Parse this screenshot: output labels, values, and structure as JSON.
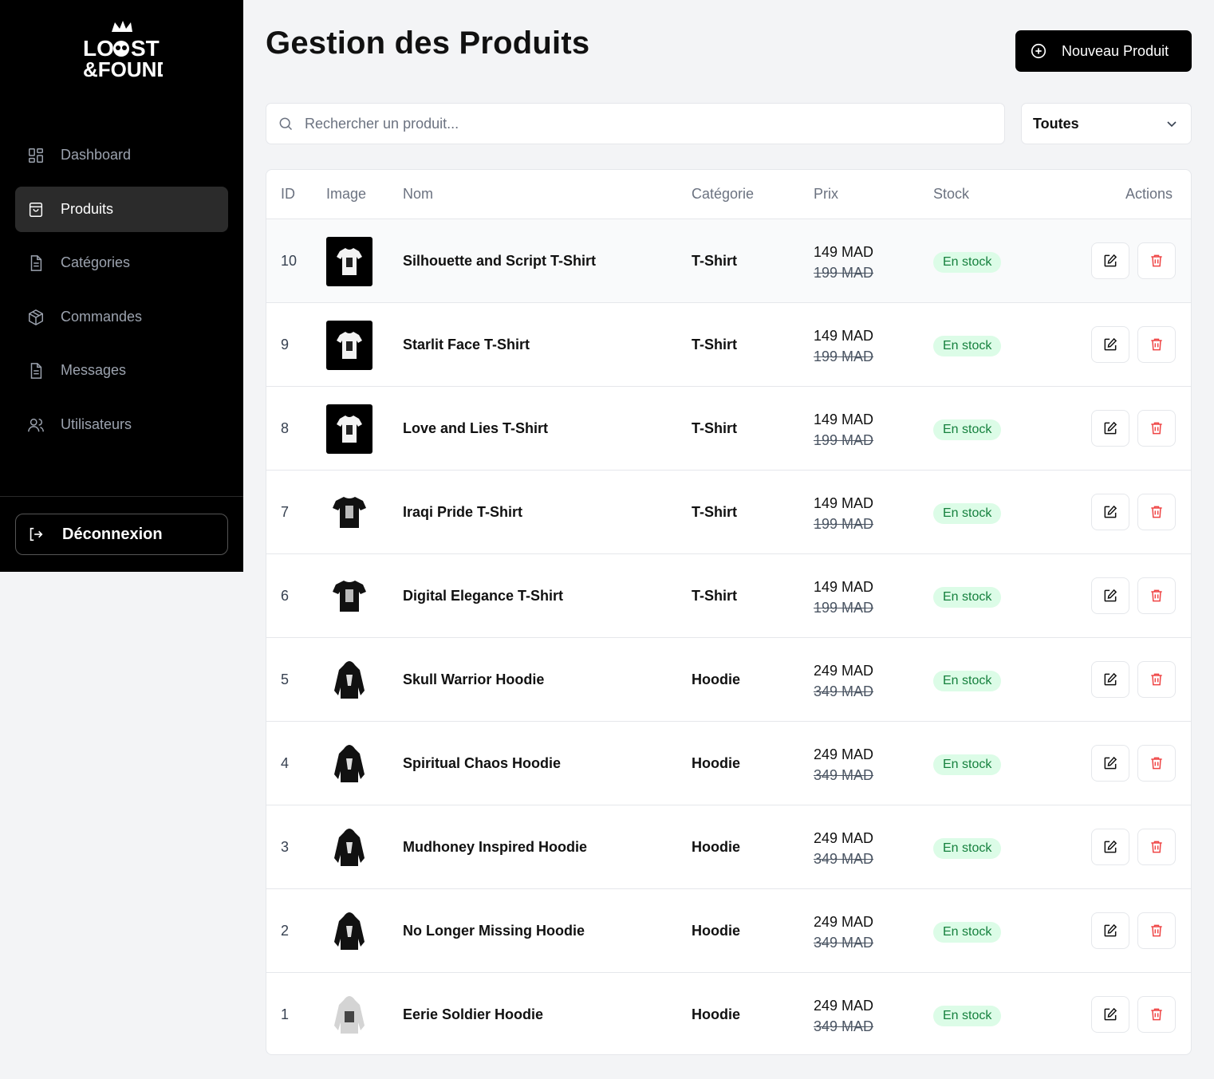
{
  "brand": {
    "logo_text_top": "LOST",
    "logo_text_bottom": "&FOUND"
  },
  "sidebar": {
    "items": [
      {
        "label": "Dashboard",
        "icon": "grid-icon"
      },
      {
        "label": "Produits",
        "icon": "shopping-bag-icon",
        "active": true
      },
      {
        "label": "Catégories",
        "icon": "document-icon"
      },
      {
        "label": "Commandes",
        "icon": "package-icon"
      },
      {
        "label": "Messages",
        "icon": "document-icon"
      },
      {
        "label": "Utilisateurs",
        "icon": "users-icon"
      }
    ],
    "logout_label": "Déconnexion"
  },
  "header": {
    "title": "Gestion des Produits",
    "new_button_label": "Nouveau Produit"
  },
  "filters": {
    "search_placeholder": "Rechercher un produit...",
    "category_selected": "Toutes"
  },
  "table": {
    "columns": [
      "ID",
      "Image",
      "Nom",
      "Catégorie",
      "Prix",
      "Stock",
      "Actions"
    ],
    "rows": [
      {
        "id": "10",
        "name": "Silhouette and Script T-Shirt",
        "category": "T-Shirt",
        "price": "149 MAD",
        "old_price": "199 MAD",
        "stock": "En stock",
        "image": "tshirt-black-bg"
      },
      {
        "id": "9",
        "name": "Starlit Face T-Shirt",
        "category": "T-Shirt",
        "price": "149 MAD",
        "old_price": "199 MAD",
        "stock": "En stock",
        "image": "tshirt-black-bg"
      },
      {
        "id": "8",
        "name": "Love and Lies T-Shirt",
        "category": "T-Shirt",
        "price": "149 MAD",
        "old_price": "199 MAD",
        "stock": "En stock",
        "image": "tshirt-black-bg"
      },
      {
        "id": "7",
        "name": "Iraqi Pride T-Shirt",
        "category": "T-Shirt",
        "price": "149 MAD",
        "old_price": "199 MAD",
        "stock": "En stock",
        "image": "tshirt-black"
      },
      {
        "id": "6",
        "name": "Digital Elegance T-Shirt",
        "category": "T-Shirt",
        "price": "149 MAD",
        "old_price": "199 MAD",
        "stock": "En stock",
        "image": "tshirt-black"
      },
      {
        "id": "5",
        "name": "Skull Warrior Hoodie",
        "category": "Hoodie",
        "price": "249 MAD",
        "old_price": "349 MAD",
        "stock": "En stock",
        "image": "hoodie-black"
      },
      {
        "id": "4",
        "name": "Spiritual Chaos Hoodie",
        "category": "Hoodie",
        "price": "249 MAD",
        "old_price": "349 MAD",
        "stock": "En stock",
        "image": "hoodie-black"
      },
      {
        "id": "3",
        "name": "Mudhoney Inspired Hoodie",
        "category": "Hoodie",
        "price": "249 MAD",
        "old_price": "349 MAD",
        "stock": "En stock",
        "image": "hoodie-black"
      },
      {
        "id": "2",
        "name": "No Longer Missing Hoodie",
        "category": "Hoodie",
        "price": "249 MAD",
        "old_price": "349 MAD",
        "stock": "En stock",
        "image": "hoodie-black"
      },
      {
        "id": "1",
        "name": "Eerie Soldier Hoodie",
        "category": "Hoodie",
        "price": "249 MAD",
        "old_price": "349 MAD",
        "stock": "En stock",
        "image": "hoodie-grey"
      }
    ]
  },
  "colors": {
    "sidebar_bg": "#000000",
    "active_item_bg": "#2b2b2b",
    "stock_badge_bg": "#dcfce7",
    "stock_badge_text": "#15803d",
    "delete_icon": "#ef4444"
  }
}
